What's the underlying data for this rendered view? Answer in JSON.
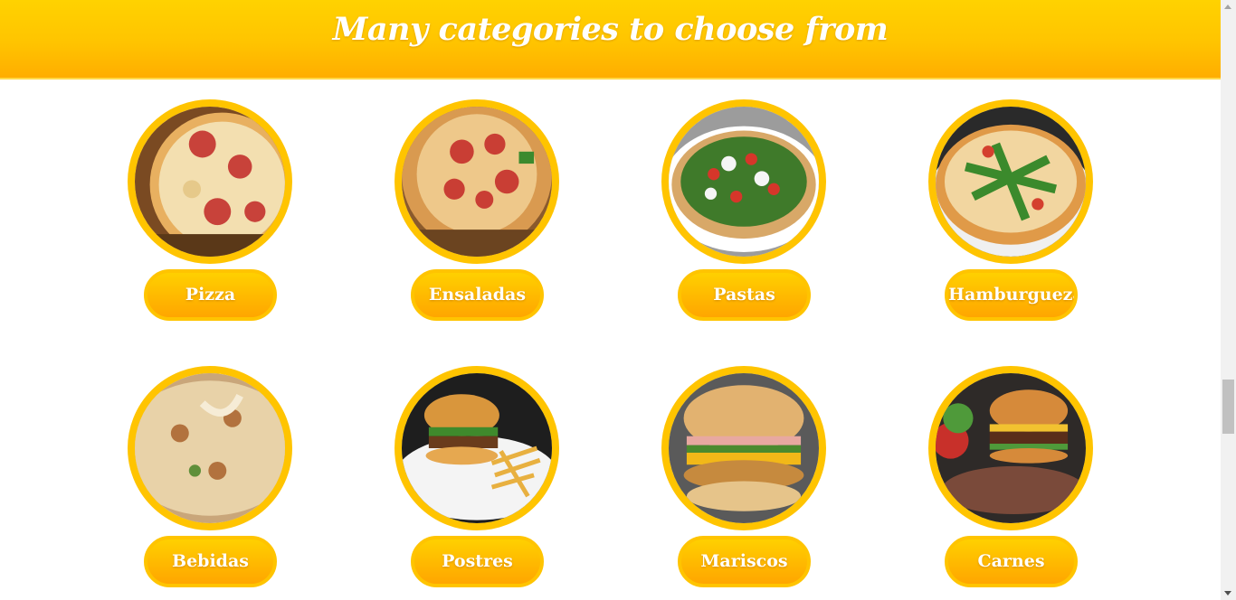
{
  "header": {
    "title": "Many categories to choose from"
  },
  "categories": [
    {
      "label": "Pizza",
      "photo_icon": "pizza-photo"
    },
    {
      "label": "Ensaladas",
      "photo_icon": "pizza-photo"
    },
    {
      "label": "Pastas",
      "photo_icon": "arugula-pizza-photo"
    },
    {
      "label": "Hamburgueza",
      "photo_icon": "arugula-pizza-photo"
    },
    {
      "label": "Bebidas",
      "photo_icon": "cheese-pizza-photo"
    },
    {
      "label": "Postres",
      "photo_icon": "burger-fries-photo"
    },
    {
      "label": "Mariscos",
      "photo_icon": "chicken-burger-photo"
    },
    {
      "label": "Carnes",
      "photo_icon": "burger-photo"
    }
  ],
  "colors": {
    "accent": "#ffc400",
    "header_top": "#ffd200",
    "header_bottom": "#ffad00",
    "text": "#ffffff"
  }
}
